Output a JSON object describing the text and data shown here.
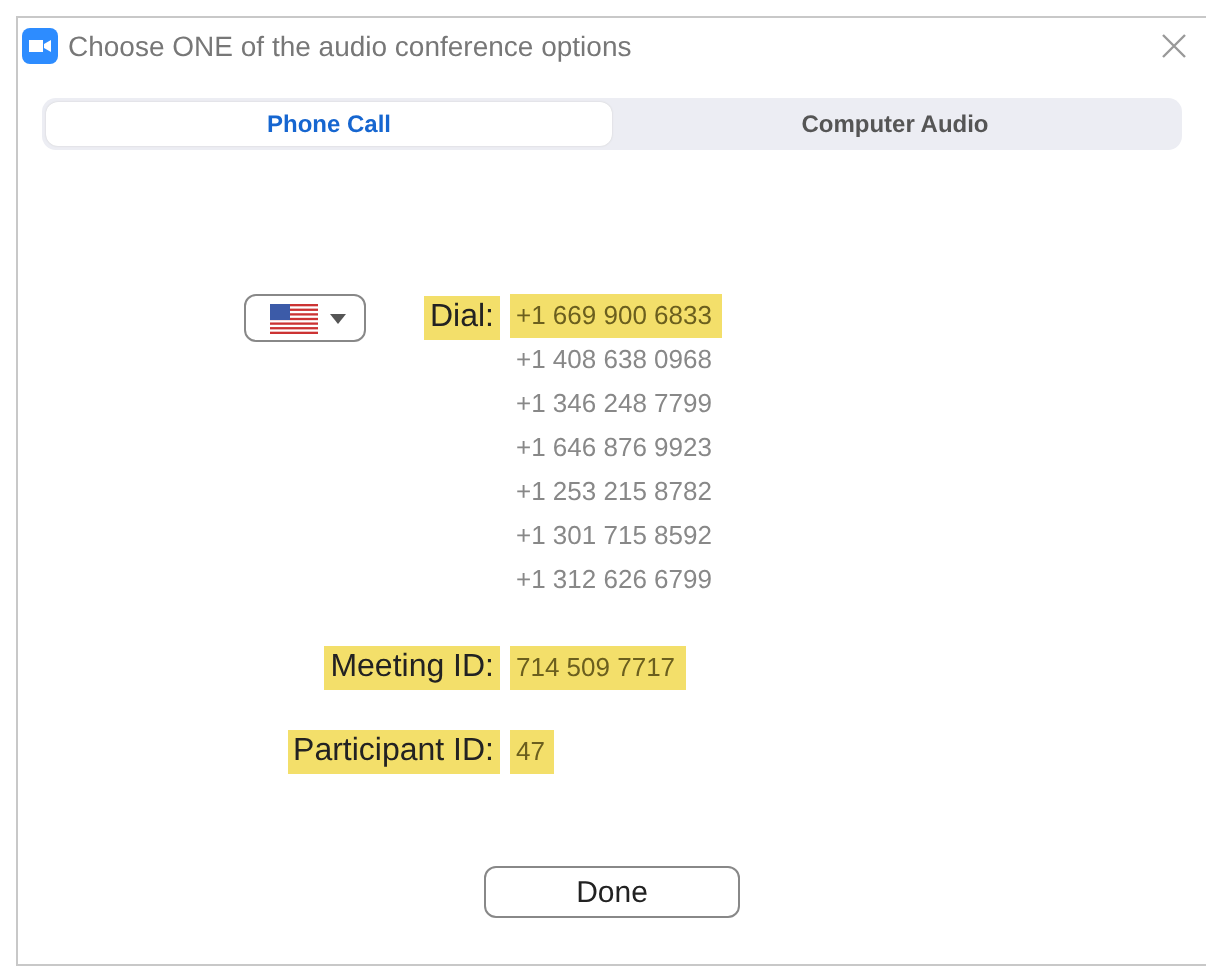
{
  "window": {
    "title": "Choose ONE of the audio conference options"
  },
  "tabs": [
    {
      "label": "Phone Call",
      "selected": true
    },
    {
      "label": "Computer Audio",
      "selected": false
    }
  ],
  "dial": {
    "label": "Dial:",
    "numbers": [
      {
        "number": "+1 669 900 6833",
        "highlighted": true
      },
      {
        "number": "+1 408 638 0968",
        "highlighted": false
      },
      {
        "number": "+1 346 248 7799",
        "highlighted": false
      },
      {
        "number": "+1 646 876 9923",
        "highlighted": false
      },
      {
        "number": "+1 253 215 8782",
        "highlighted": false
      },
      {
        "number": "+1 301 715 8592",
        "highlighted": false
      },
      {
        "number": "+1 312 626 6799",
        "highlighted": false
      }
    ]
  },
  "meeting_id": {
    "label": "Meeting ID:",
    "value": "714 509 7717"
  },
  "participant_id": {
    "label": "Participant ID:",
    "value": "47"
  },
  "buttons": [
    {
      "label": "Done"
    }
  ]
}
